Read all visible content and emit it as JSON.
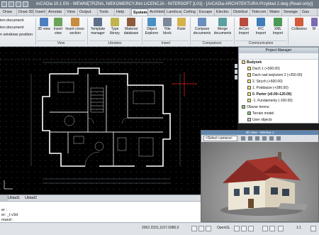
{
  "app": {
    "title": "ArCADia 10.1 EN - WEWNĘTRZNA, NIEKOMERCYJNA LICENCJA - INTERSOFT [L01] - [ArCADia-ARCHITEKTURA Przykład 2.dwg (Read-only)]"
  },
  "ribbon": {
    "tabs": [
      "Draw",
      "Draw 3D",
      "Insert",
      "Annotat",
      "View",
      "Output",
      "Tools",
      "Help",
      "System",
      "Architekt",
      "Landsca",
      "Ceiling",
      "Escape",
      "Electric",
      "Distribut",
      "Telecom",
      "Water",
      "Sewage",
      "Gas"
    ],
    "active_tab": "System",
    "left_items": [
      "ten document",
      "ten document",
      "n windows position"
    ],
    "groups": {
      "view": "View",
      "libraries": "Libraries",
      "insert": "Insert",
      "comparison": "Comparison",
      "communication": "Communication"
    },
    "buttons": {
      "view_3d": "3D view",
      "insert_view": "Insert view",
      "insert_cross_section": "Insert cross-section",
      "template_manager": "Template manager",
      "type_library": "Type library",
      "material_database": "Material database",
      "object_explorer": "Object Explorer",
      "title_block": "Title block",
      "ruler": "Ruler",
      "compare_documents": "Compare documents",
      "merge_documents": "Merge documents",
      "arcon_import": "ArCon Import",
      "ifc_import": "IFC Import",
      "xml_import": "XML Import",
      "collisions": "Collisions",
      "more": "M"
    }
  },
  "project_manager": {
    "title": "Project Manager",
    "items": [
      "Budynek",
      "Dach 1 (+500.00)",
      "Dach nad wejściem 2 (+250.00)",
      "2. Strych (+500.00)",
      "1. Poddasze (+280.00)",
      "0. Parter (±0.00÷120.00)",
      "-1. Fundamenty (-100.00)",
      "Obszar terenu",
      "Terrain model",
      "User objects"
    ]
  },
  "view3d": {
    "title": "3D view - Window 1",
    "camera": "<Select camera>"
  },
  "layouts": {
    "tabs": [
      "Układ1",
      "Układ2"
    ]
  },
  "command": {
    "lines": [
      "",
      "er :",
      "er: _t v3d",
      "mand :"
    ]
  },
  "status": {
    "coords": "2062.2331,1157.0985,0",
    "opengl": "OpenGL",
    "scale": "1:1"
  },
  "colors": {
    "ribbon_bg": "#eef1f4",
    "drawing_bg": "#000000",
    "titlebar": "#6f7a86",
    "walls": "#ffffff",
    "crosshair": "#ff0000"
  }
}
